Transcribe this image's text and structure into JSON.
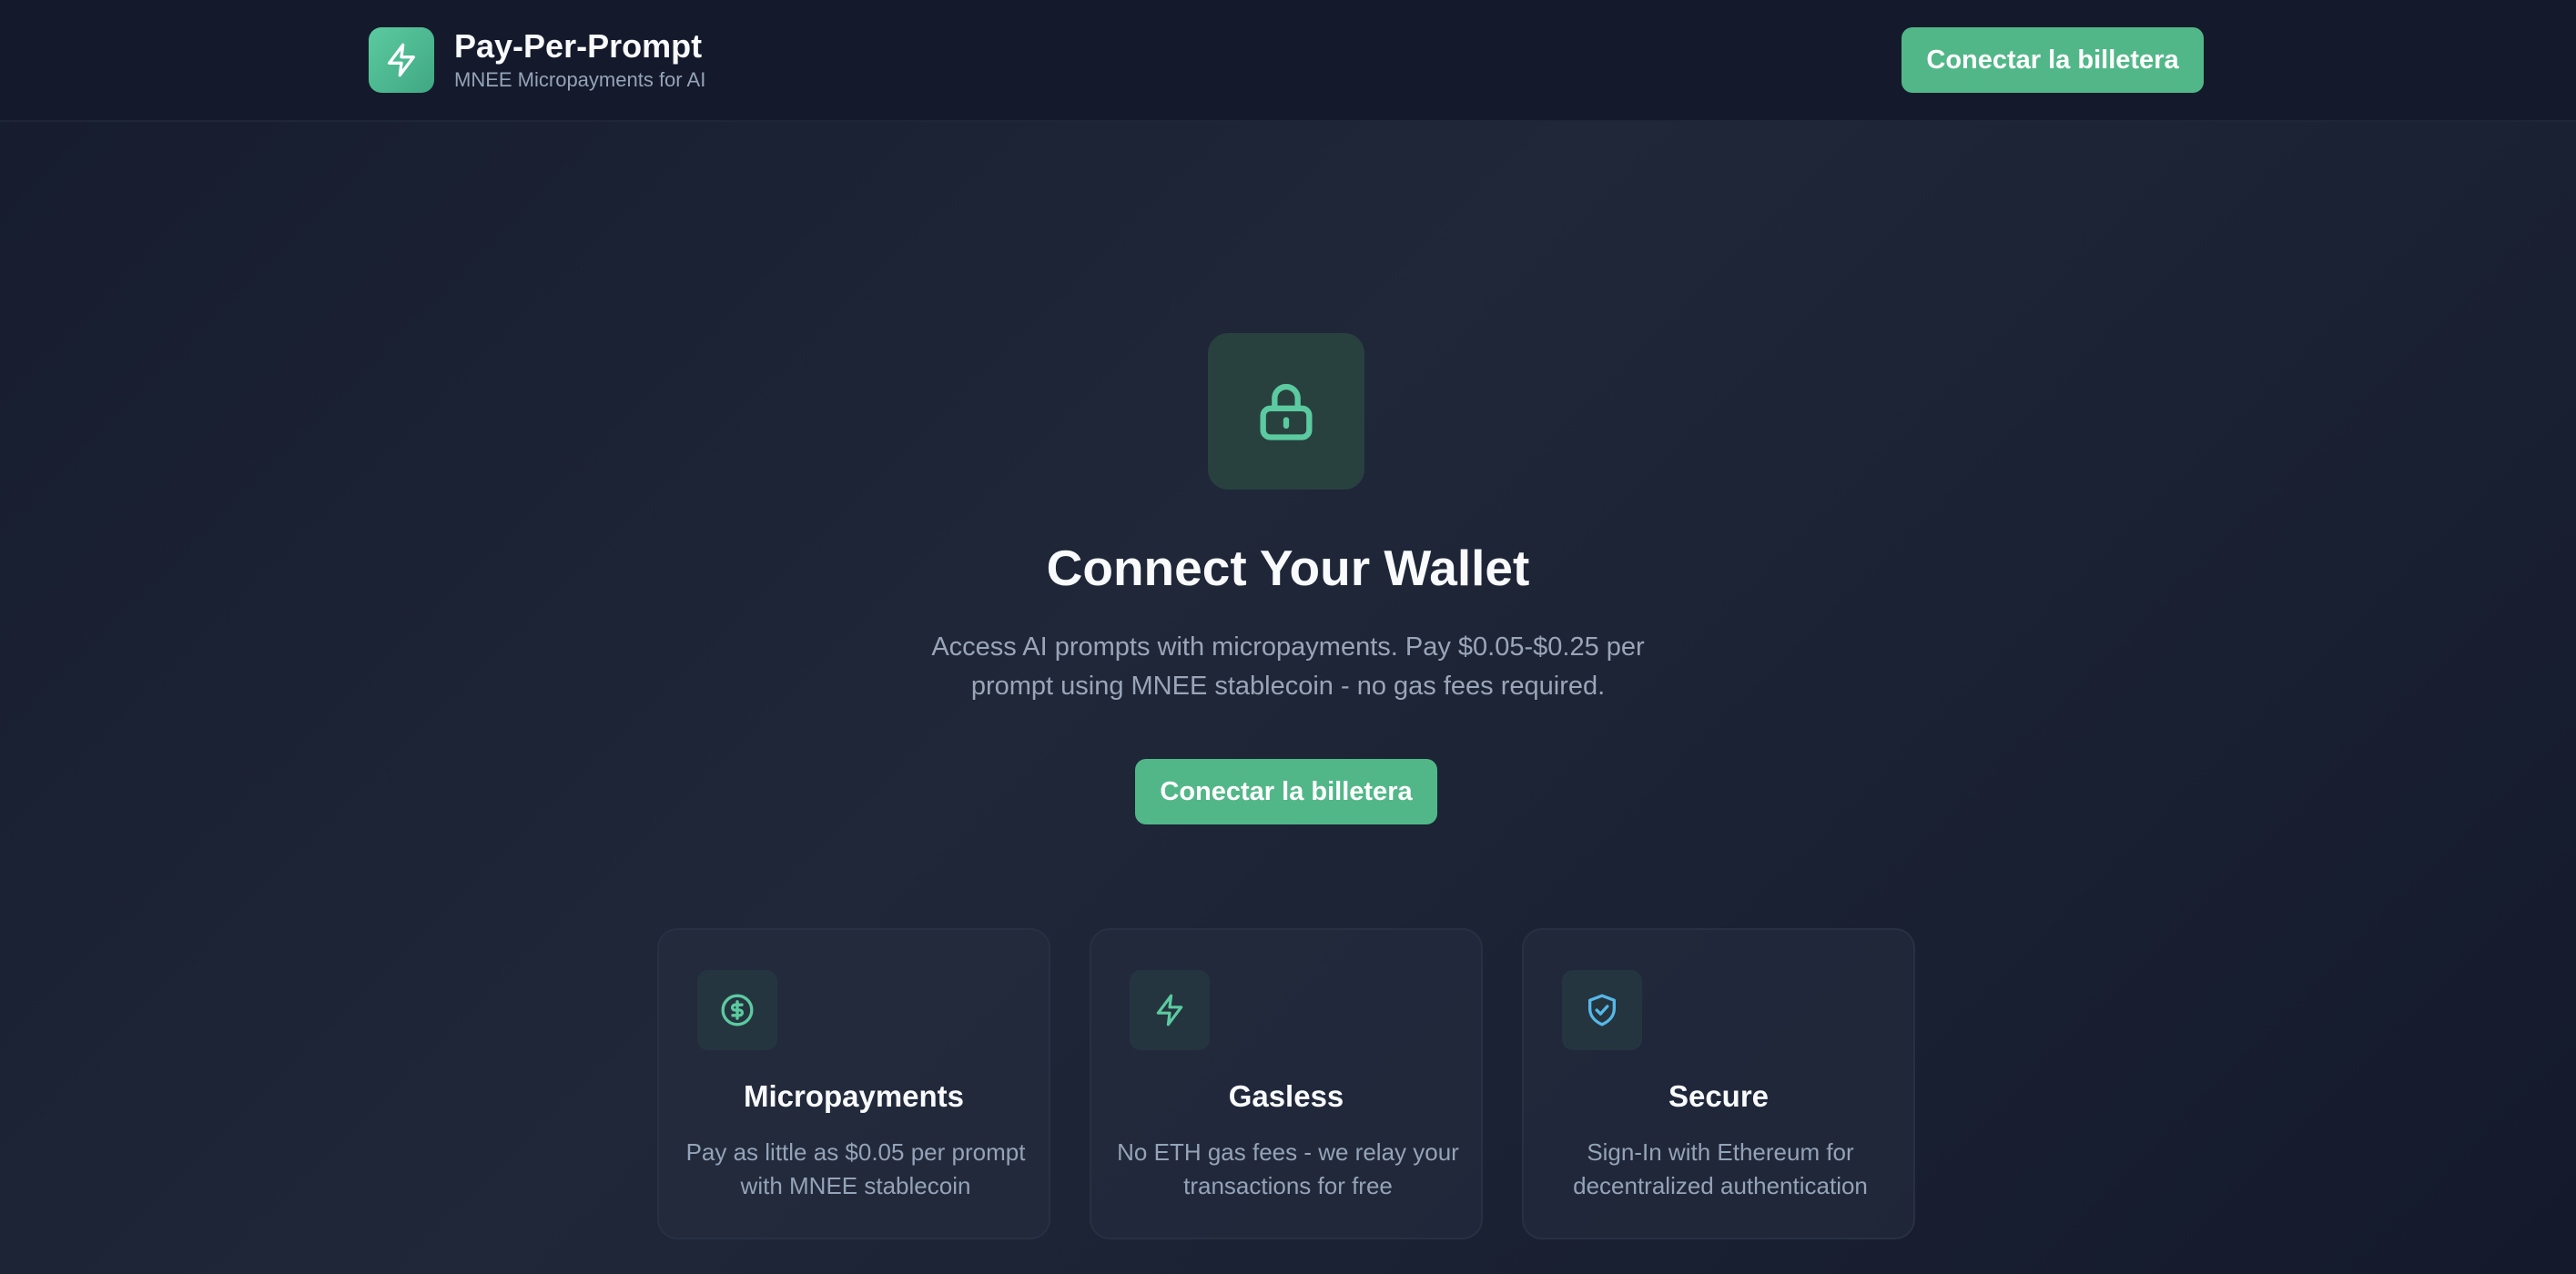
{
  "header": {
    "title": "Pay-Per-Prompt",
    "subtitle": "MNEE Micropayments for AI",
    "connect_button": "Conectar la billetera",
    "logo_icon": "lightning-bolt-icon"
  },
  "hero": {
    "icon": "lock-icon",
    "title": "Connect Your Wallet",
    "description": "Access AI prompts with micropayments. Pay $0.05-$0.25 per prompt using MNEE stablecoin - no gas fees required.",
    "connect_button": "Conectar la billetera"
  },
  "features": [
    {
      "icon": "dollar-circle-icon",
      "title": "Micropayments",
      "description": "Pay as little as $0.05 per prompt with MNEE stablecoin"
    },
    {
      "icon": "lightning-bolt-icon",
      "title": "Gasless",
      "description": "No ETH gas fees - we relay your transactions for free"
    },
    {
      "icon": "shield-check-icon",
      "title": "Secure",
      "description": "Sign-In with Ethereum for decentralized authentication"
    }
  ],
  "colors": {
    "accent": "#52b788",
    "icon_green": "#5ccaa0",
    "icon_blue": "#56b8e8",
    "background": "#1b2233"
  }
}
